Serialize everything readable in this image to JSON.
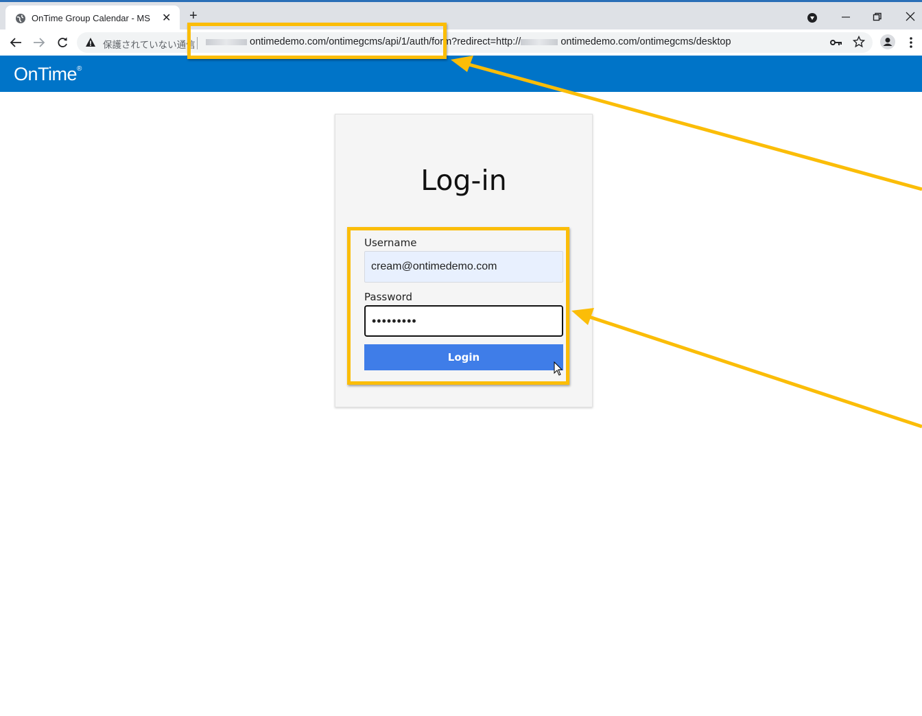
{
  "browser": {
    "tab_title": "OnTime Group Calendar - MS",
    "tab_close_glyph": "✕",
    "new_tab_glyph": "+",
    "security_warning": "保護されていない通信",
    "url_segment_1": "ontimedemo.com/ontimegcms/api/1/auth/form?redirect=http://",
    "url_segment_2": "ontimedemo.com/ontimegcms/desktop",
    "icons": {
      "favicon": "globe-icon",
      "back": "back-arrow-icon",
      "forward": "forward-arrow-icon",
      "reload": "reload-icon",
      "warning": "warning-triangle-icon",
      "key": "key-icon",
      "star": "star-icon",
      "profile": "profile-icon",
      "menu": "kebab-menu-icon",
      "extension": "extension-icon"
    }
  },
  "app": {
    "logo_text": "OnTime",
    "logo_mark": "®",
    "brand_color": "#0074c8"
  },
  "login": {
    "heading": "Log-in",
    "username_label": "Username",
    "username_value": "cream@ontimedemo.com",
    "password_label": "Password",
    "password_value": "•••••••••",
    "login_button": "Login",
    "button_color": "#3f7de8"
  },
  "annotations": {
    "highlight_color": "#fbbd08"
  }
}
